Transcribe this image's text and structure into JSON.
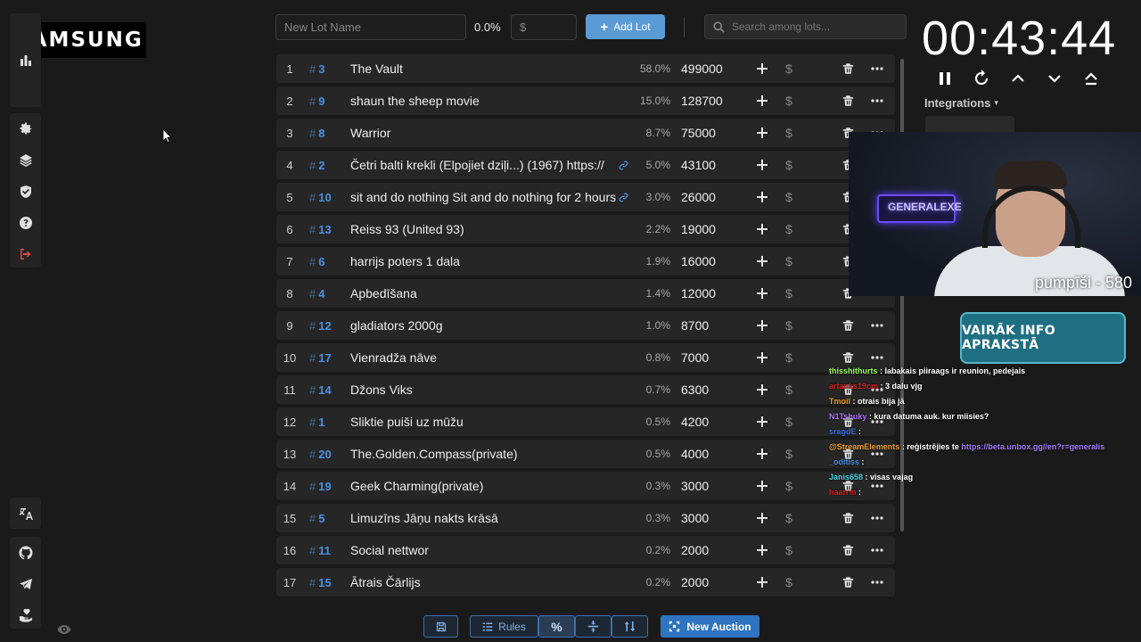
{
  "brand": {
    "label": "SAMSUNG"
  },
  "controls": {
    "lot_name_placeholder": "New Lot Name",
    "percent": "0.0%",
    "amount_placeholder": "$",
    "add_lot_label": "Add Lot",
    "search_placeholder": "Search among lots..."
  },
  "lots": [
    {
      "idx": "1",
      "id": "3",
      "name": "The Vault",
      "pct": "58.0%",
      "amount": "499000",
      "link": false
    },
    {
      "idx": "2",
      "id": "9",
      "name": "shaun the sheep movie",
      "pct": "15.0%",
      "amount": "128700",
      "link": false
    },
    {
      "idx": "3",
      "id": "8",
      "name": "Warrior",
      "pct": "8.7%",
      "amount": "75000",
      "link": false
    },
    {
      "idx": "4",
      "id": "2",
      "name": "Četri balti krekli (Elpojiet dziļi...) (1967) https://",
      "pct": "5.0%",
      "amount": "43100",
      "link": true
    },
    {
      "idx": "5",
      "id": "10",
      "name": "sit and do nothing Sit and do nothing for 2 hours",
      "pct": "3.0%",
      "amount": "26000",
      "link": true
    },
    {
      "idx": "6",
      "id": "13",
      "name": "Reiss 93 (United 93)",
      "pct": "2.2%",
      "amount": "19000",
      "link": false
    },
    {
      "idx": "7",
      "id": "6",
      "name": "harrijs poters 1 dala",
      "pct": "1.9%",
      "amount": "16000",
      "link": false
    },
    {
      "idx": "8",
      "id": "4",
      "name": "Apbedīšana",
      "pct": "1.4%",
      "amount": "12000",
      "link": false
    },
    {
      "idx": "9",
      "id": "12",
      "name": "gladiators 2000g",
      "pct": "1.0%",
      "amount": "8700",
      "link": false
    },
    {
      "idx": "10",
      "id": "17",
      "name": "Vienradža nāve",
      "pct": "0.8%",
      "amount": "7000",
      "link": false
    },
    {
      "idx": "11",
      "id": "14",
      "name": "Džons Viks",
      "pct": "0.7%",
      "amount": "6300",
      "link": false
    },
    {
      "idx": "12",
      "id": "1",
      "name": "Sliktie puiši uz mūžu",
      "pct": "0.5%",
      "amount": "4200",
      "link": false
    },
    {
      "idx": "13",
      "id": "20",
      "name": "The.Golden.Compass(private)",
      "pct": "0.5%",
      "amount": "4000",
      "link": false
    },
    {
      "idx": "14",
      "id": "19",
      "name": "Geek Charming(private)",
      "pct": "0.3%",
      "amount": "3000",
      "link": false
    },
    {
      "idx": "15",
      "id": "5",
      "name": "Limuzīns Jāņu nakts krāsā",
      "pct": "0.3%",
      "amount": "3000",
      "link": false
    },
    {
      "idx": "16",
      "id": "11",
      "name": "Social nettwor",
      "pct": "0.2%",
      "amount": "2000",
      "link": false
    },
    {
      "idx": "17",
      "id": "15",
      "name": "Ātrais Čārlijs",
      "pct": "0.2%",
      "amount": "2000",
      "link": false
    }
  ],
  "toolbar": {
    "rules_label": "Rules",
    "new_auction_label": "New Auction"
  },
  "timer": {
    "value": "00:43:44"
  },
  "integrations": {
    "label": "Integrations"
  },
  "stream": {
    "neon_sign": "GENERALEXE",
    "caption": "pumpīši - 580",
    "info_banner": "VAIRĀK INFO APRAKSTĀ"
  },
  "chat": [
    {
      "user": "thisshithurts",
      "user_color": "#9cff5a",
      "msg": "labakais piiraags ir reunion, pedejais"
    },
    {
      "user": "artanks19cm",
      "user_color": "#d02020",
      "msg": "3 dalu vjg"
    },
    {
      "user": "Tmoil",
      "user_color": "#e8a020",
      "msg": "otrais bija jā"
    },
    {
      "user": "N1Tshuky",
      "user_color": "#b070ff",
      "msg": "kura datuma auk. kur miisies?"
    },
    {
      "user": "sragdE",
      "user_color": "#3a70e0",
      "msg": ""
    },
    {
      "user": "@StreamElements",
      "user_color": "#f0a030",
      "msg": "reģistrējies te",
      "link": "https://beta.unbox.gg//en?r=generalis"
    },
    {
      "user": "_oditiss",
      "user_color": "#4a90e2",
      "msg": ""
    },
    {
      "user": "Janis658",
      "user_color": "#4ad0e0",
      "msg": "visas vajag"
    },
    {
      "user": "haarrm",
      "user_color": "#d02020",
      "msg": ""
    }
  ]
}
